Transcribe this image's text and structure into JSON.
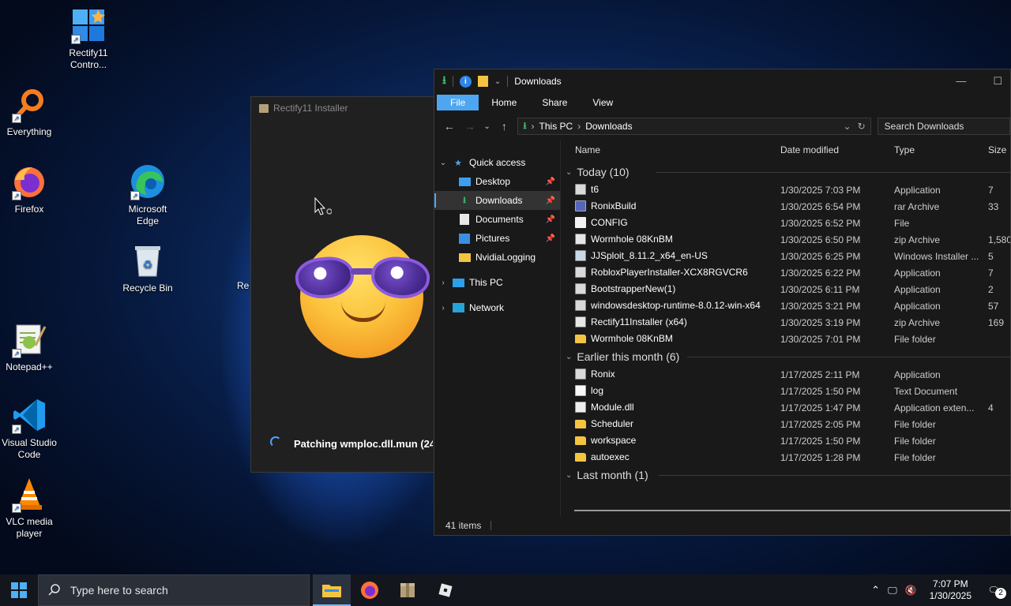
{
  "desktop": {
    "icons": [
      {
        "label": "Rectify11 Contro..."
      },
      {
        "label": "Everything"
      },
      {
        "label": "Firefox"
      },
      {
        "label": "Microsoft Edge"
      },
      {
        "label": "Recycle Bin"
      },
      {
        "label": "Notepad++"
      },
      {
        "label": "Visual Studio Code"
      },
      {
        "label": "VLC media player"
      },
      {
        "label": "Re"
      }
    ]
  },
  "installer": {
    "title": "Rectify11 Installer",
    "status": "Patching wmploc.dll.mun (24"
  },
  "explorer": {
    "title": "Downloads",
    "ribbon": [
      "File",
      "Home",
      "Share",
      "View"
    ],
    "address": {
      "part1": "This PC",
      "part2": "Downloads"
    },
    "search_placeholder": "Search Downloads",
    "nav": {
      "quick_access": "Quick access",
      "desktop": "Desktop",
      "downloads": "Downloads",
      "documents": "Documents",
      "pictures": "Pictures",
      "nvidia": "NvidiaLogging",
      "this_pc": "This PC",
      "network": "Network"
    },
    "columns": {
      "name": "Name",
      "date": "Date modified",
      "type": "Type",
      "size": "Size"
    },
    "groups": {
      "today": "Today (10)",
      "earlier": "Earlier this month (6)",
      "last": "Last month (1)"
    },
    "today_files": [
      {
        "name": "t6",
        "date": "1/30/2025 7:03 PM",
        "type": "Application",
        "size": "7"
      },
      {
        "name": "RonixBuild",
        "date": "1/30/2025 6:54 PM",
        "type": "rar Archive",
        "size": "33"
      },
      {
        "name": "CONFIG",
        "date": "1/30/2025 6:52 PM",
        "type": "File",
        "size": ""
      },
      {
        "name": "Wormhole 08KnBM",
        "date": "1/30/2025 6:50 PM",
        "type": "zip Archive",
        "size": "1,580"
      },
      {
        "name": "JJSploit_8.11.2_x64_en-US",
        "date": "1/30/2025 6:25 PM",
        "type": "Windows Installer ...",
        "size": "5"
      },
      {
        "name": "RobloxPlayerInstaller-XCX8RGVCR6",
        "date": "1/30/2025 6:22 PM",
        "type": "Application",
        "size": "7"
      },
      {
        "name": "BootstrapperNew(1)",
        "date": "1/30/2025 6:11 PM",
        "type": "Application",
        "size": "2"
      },
      {
        "name": "windowsdesktop-runtime-8.0.12-win-x64",
        "date": "1/30/2025 3:21 PM",
        "type": "Application",
        "size": "57"
      },
      {
        "name": "Rectify11Installer (x64)",
        "date": "1/30/2025 3:19 PM",
        "type": "zip Archive",
        "size": "169"
      },
      {
        "name": "Wormhole 08KnBM",
        "date": "1/30/2025 7:01 PM",
        "type": "File folder",
        "size": ""
      }
    ],
    "earlier_files": [
      {
        "name": "Ronix",
        "date": "1/17/2025 2:11 PM",
        "type": "Application",
        "size": ""
      },
      {
        "name": "log",
        "date": "1/17/2025 1:50 PM",
        "type": "Text Document",
        "size": ""
      },
      {
        "name": "Module.dll",
        "date": "1/17/2025 1:47 PM",
        "type": "Application exten...",
        "size": "4"
      },
      {
        "name": "Scheduler",
        "date": "1/17/2025 2:05 PM",
        "type": "File folder",
        "size": ""
      },
      {
        "name": "workspace",
        "date": "1/17/2025 1:50 PM",
        "type": "File folder",
        "size": ""
      },
      {
        "name": "autoexec",
        "date": "1/17/2025 1:28 PM",
        "type": "File folder",
        "size": ""
      }
    ],
    "status": "41 items"
  },
  "taskbar": {
    "search_placeholder": "Type here to search",
    "time": "7:07 PM",
    "date": "1/30/2025",
    "notification_count": "2"
  }
}
